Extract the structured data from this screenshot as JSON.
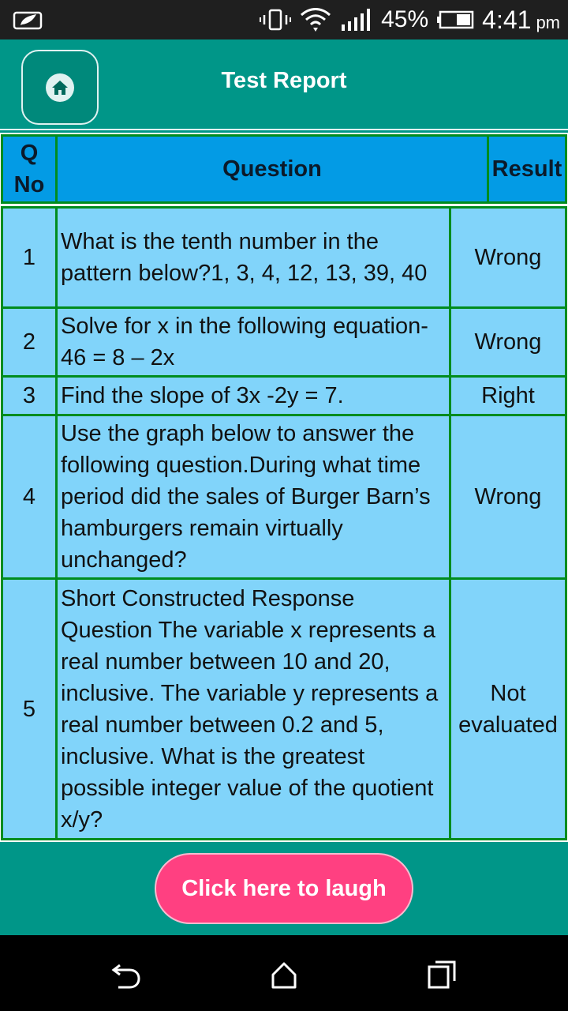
{
  "status_bar": {
    "battery_percent": "45%",
    "time": "4:41",
    "ampm": "pm"
  },
  "header": {
    "title": "Test Report"
  },
  "table": {
    "headers": {
      "qno": "Q No",
      "question": "Question",
      "result": "Result"
    },
    "rows": [
      {
        "qno": "1",
        "question": "What is the tenth number in the pattern below?1, 3, 4, 12, 13, 39, 40",
        "result": "Wrong"
      },
      {
        "qno": "2",
        "question": "Solve for x in the following equation- 46 = 8 – 2x",
        "result": "Wrong"
      },
      {
        "qno": "3",
        "question": "Find the slope of 3x -2y = 7.",
        "result": "Right"
      },
      {
        "qno": "4",
        "question": "Use the graph below to answer the following question.During what time period did the sales of Burger Barn’s hamburgers remain virtually unchanged?",
        "result": "Wrong"
      },
      {
        "qno": "5",
        "question": "Short Constructed Response Question The variable x represents a real number between 10 and 20, inclusive. The variable y represents a real number between 0.2 and 5, inclusive. What is the greatest possible integer value of the quotient x/y?",
        "result": "Not evaluated"
      }
    ]
  },
  "footer": {
    "laugh_button": "Click here to laugh"
  },
  "colors": {
    "primary": "#009688",
    "header_cell": "#039be5",
    "body_cell": "#81d4fa",
    "grid": "#008c1e",
    "accent_button": "#ff4081"
  },
  "icons": {
    "home": "home-icon",
    "back": "back-icon",
    "nav_home": "nav-home-icon",
    "recents": "recents-icon"
  }
}
